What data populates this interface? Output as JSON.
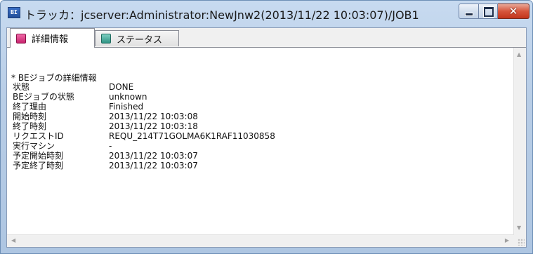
{
  "window": {
    "title": "トラッカ：jcserver:Administrator:NewJnw2(2013/11/22 10:03:07)/JOB1",
    "app_icon_text": "BI"
  },
  "tabs": [
    {
      "label": "詳細情報",
      "active": true,
      "icon": "detail-tab-icon"
    },
    {
      "label": "ステータス",
      "active": false,
      "icon": "status-tab-icon"
    }
  ],
  "detail": {
    "heading": "* BEジョブの詳細情報",
    "rows": [
      {
        "key": "状態",
        "value": "DONE"
      },
      {
        "key": "BEジョブの状態",
        "value": "unknown"
      },
      {
        "key": "終了理由",
        "value": "Finished"
      },
      {
        "key": "開始時刻",
        "value": "2013/11/22 10:03:08"
      },
      {
        "key": "終了時刻",
        "value": "2013/11/22 10:03:18"
      },
      {
        "key": "リクエストID",
        "value": "REQU_214T71GOLMA6K1RAF11030858"
      },
      {
        "key": "実行マシン",
        "value": "-"
      },
      {
        "key": "予定開始時刻",
        "value": "2013/11/22 10:03:07"
      },
      {
        "key": "予定終了時刻",
        "value": "2013/11/22 10:03:07"
      }
    ]
  },
  "colors": {
    "titlebar": "#c7daf0",
    "close_button": "#d6553c",
    "client_bg": "#ffffff"
  }
}
